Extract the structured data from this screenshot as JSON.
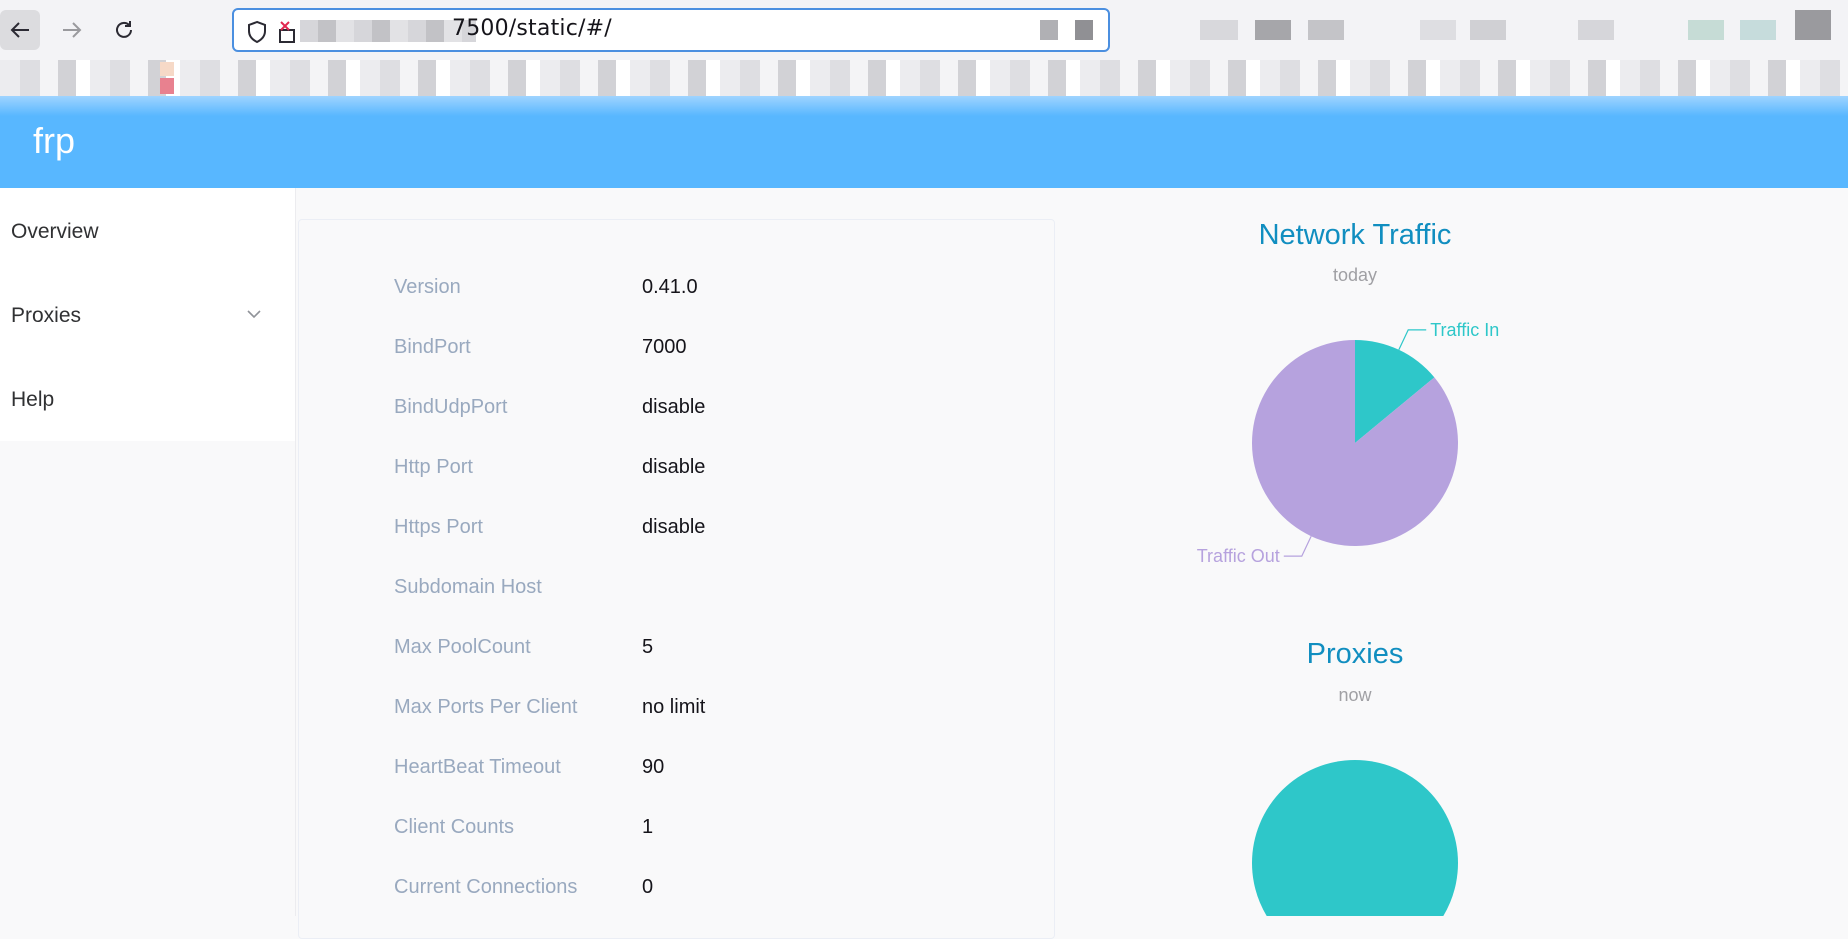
{
  "browser": {
    "url_visible": "7500/static/#/"
  },
  "header": {
    "title": "frp"
  },
  "sidebar": {
    "items": [
      {
        "label": "Overview"
      },
      {
        "label": "Proxies"
      },
      {
        "label": "Help"
      }
    ]
  },
  "info": {
    "rows": [
      {
        "label": "Version",
        "value": "0.41.0"
      },
      {
        "label": "BindPort",
        "value": "7000"
      },
      {
        "label": "BindUdpPort",
        "value": "disable"
      },
      {
        "label": "Http Port",
        "value": "disable"
      },
      {
        "label": "Https Port",
        "value": "disable"
      },
      {
        "label": "Subdomain Host",
        "value": ""
      },
      {
        "label": "Max PoolCount",
        "value": "5"
      },
      {
        "label": "Max Ports Per Client",
        "value": "no limit"
      },
      {
        "label": "HeartBeat Timeout",
        "value": "90"
      },
      {
        "label": "Client Counts",
        "value": "1"
      },
      {
        "label": "Current Connections",
        "value": "0"
      }
    ]
  },
  "chart_data": [
    {
      "type": "pie",
      "title": "Network Traffic",
      "subtitle": "today",
      "slices": [
        {
          "name": "Traffic In",
          "value": 14,
          "color": "#2ec7c9"
        },
        {
          "name": "Traffic Out",
          "value": 86,
          "color": "#b6a2de"
        }
      ]
    },
    {
      "type": "pie",
      "title": "Proxies",
      "subtitle": "now",
      "slices": [
        {
          "name": "",
          "value": 100,
          "color": "#2ec7c9"
        }
      ]
    }
  ],
  "colors": {
    "header": "#58b7ff",
    "chart_title": "#118ec0",
    "info_label": "#99a9bf",
    "slice_in": "#2ec7c9",
    "slice_out": "#b6a2de"
  }
}
